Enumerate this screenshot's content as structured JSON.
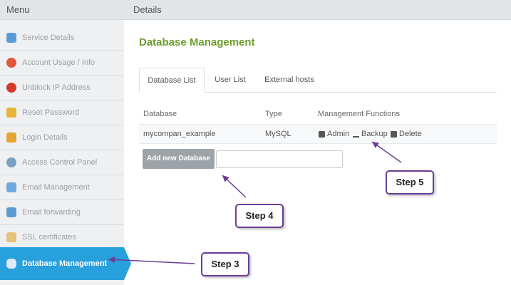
{
  "sidebar": {
    "header": "Menu",
    "items": [
      {
        "label": "Service Details",
        "icon": "monitor-icon"
      },
      {
        "label": "Account Usage / Info",
        "icon": "pie-chart-icon"
      },
      {
        "label": "Unblock IP Address",
        "icon": "block-icon"
      },
      {
        "label": "Reset Password",
        "icon": "key-icon"
      },
      {
        "label": "Login Details",
        "icon": "lock-icon"
      },
      {
        "label": "Access Control Panel",
        "icon": "gear-icon"
      },
      {
        "label": "Email Management",
        "icon": "email-window-icon"
      },
      {
        "label": "Email forwarding",
        "icon": "email-forward-icon"
      },
      {
        "label": "SSL certificates",
        "icon": "certificate-icon"
      },
      {
        "label": "Database Management",
        "icon": "database-icon"
      }
    ]
  },
  "topbar": {
    "title": "Details"
  },
  "main": {
    "title": "Database Management",
    "tabs": [
      {
        "label": "Database List",
        "active": true
      },
      {
        "label": "User List",
        "active": false
      },
      {
        "label": "External hosts",
        "active": false
      }
    ],
    "table": {
      "headers": [
        "Database",
        "Type",
        "Management Functions"
      ],
      "rows": [
        {
          "database": "mycompan_example",
          "type": "MySQL",
          "functions": {
            "admin": "Admin",
            "backup": "Backup",
            "delete": "Delete"
          }
        }
      ]
    },
    "add_button": "Add new Database",
    "db_input_value": ""
  },
  "callouts": {
    "step3": "Step 3",
    "step4": "Step 4",
    "step5": "Step 5"
  },
  "colors": {
    "accent": "#27a0dc",
    "title": "#6a9d2a",
    "callout_border": "#6b3d94"
  }
}
